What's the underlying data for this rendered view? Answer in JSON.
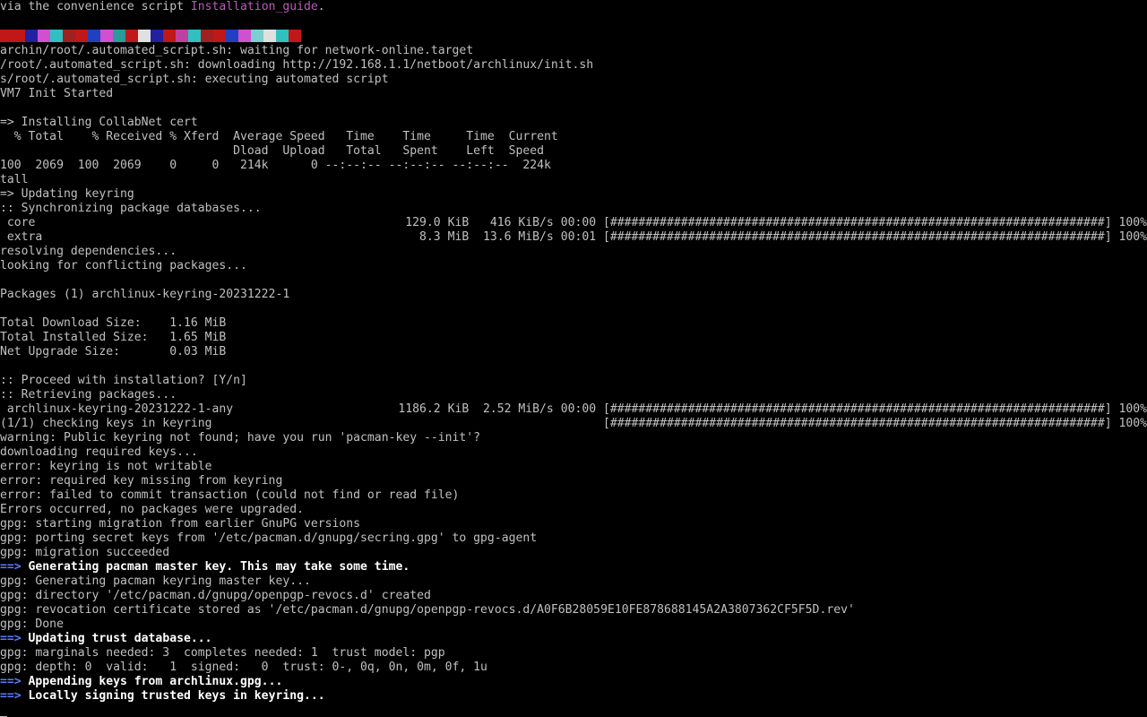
{
  "colors": {
    "background": "#000000",
    "text": "#c0c0c0",
    "bright": "#ffffff",
    "link": "#b85bb8",
    "arrow": "#5c7cff"
  },
  "banner_colors": [
    "#c01818",
    "#c01818",
    "#2020a0",
    "#d050d0",
    "#30c0c0",
    "#a02020",
    "#c01818",
    "#2040c0",
    "#d050d0",
    "#2a9a9a",
    "#c01818",
    "#e0e0e0",
    "#2020a0",
    "#c01818",
    "#c040a0",
    "#30c0c0",
    "#a02020",
    "#c01818",
    "#2040c0",
    "#d050d0",
    "#7ad0d0",
    "#e0e0e0",
    "#30c0c0",
    "#c01818"
  ],
  "lines": [
    {
      "text": "via the convenience script ",
      "link": "Installation_guide",
      "tail": "."
    },
    {
      "text": ""
    },
    {
      "banner": true
    },
    {
      "text": "archin/root/.automated_script.sh: waiting for network-online.target"
    },
    {
      "text": "/root/.automated_script.sh: downloading http://192.168.1.1/netboot/archlinux/init.sh"
    },
    {
      "text": "s/root/.automated_script.sh: executing automated script"
    },
    {
      "text": "VM7 Init Started"
    },
    {
      "text": ""
    },
    {
      "text": "=> Installing CollabNet cert"
    },
    {
      "text": "  % Total    % Received % Xferd  Average Speed   Time    Time     Time  Current"
    },
    {
      "text": "                                 Dload  Upload   Total   Spent    Left  Speed"
    },
    {
      "text": "100  2069  100  2069    0     0   214k      0 --:--:-- --:--:-- --:--:--  224k"
    },
    {
      "text": "tall"
    },
    {
      "text": "=> Updating keyring"
    },
    {
      "text": ":: Synchronizing package databases..."
    },
    {
      "text": " core",
      "right": "129.0 KiB   416 KiB/s 00:00 [######################################################################] 100%"
    },
    {
      "text": " extra",
      "right": "8.3 MiB  13.6 MiB/s 00:01 [######################################################################] 100%"
    },
    {
      "text": "resolving dependencies..."
    },
    {
      "text": "looking for conflicting packages..."
    },
    {
      "text": ""
    },
    {
      "text": "Packages (1) archlinux-keyring-20231222-1"
    },
    {
      "text": ""
    },
    {
      "text": "Total Download Size:    1.16 MiB"
    },
    {
      "text": "Total Installed Size:   1.65 MiB"
    },
    {
      "text": "Net Upgrade Size:       0.03 MiB"
    },
    {
      "text": ""
    },
    {
      "text": ":: Proceed with installation? [Y/n]"
    },
    {
      "text": ":: Retrieving packages..."
    },
    {
      "text": " archlinux-keyring-20231222-1-any",
      "right": "1186.2 KiB  2.52 MiB/s 00:00 [######################################################################] 100%"
    },
    {
      "text": "(1/1) checking keys in keyring",
      "right": "[######################################################################] 100%"
    },
    {
      "text": "warning: Public keyring not found; have you run 'pacman-key --init'?"
    },
    {
      "text": "downloading required keys..."
    },
    {
      "text": "error: keyring is not writable"
    },
    {
      "text": "error: required key missing from keyring"
    },
    {
      "text": "error: failed to commit transaction (could not find or read file)"
    },
    {
      "text": "Errors occurred, no packages were upgraded."
    },
    {
      "text": "gpg: starting migration from earlier GnuPG versions"
    },
    {
      "text": "gpg: porting secret keys from '/etc/pacman.d/gnupg/secring.gpg' to gpg-agent"
    },
    {
      "text": "gpg: migration succeeded"
    },
    {
      "arrow": "==>",
      "text": " Generating pacman master key. This may take some time.",
      "bold": true
    },
    {
      "text": "gpg: Generating pacman keyring master key..."
    },
    {
      "text": "gpg: directory '/etc/pacman.d/gnupg/openpgp-revocs.d' created"
    },
    {
      "text": "gpg: revocation certificate stored as '/etc/pacman.d/gnupg/openpgp-revocs.d/A0F6B28059E10FE878688145A2A3807362CF5F5D.rev'"
    },
    {
      "text": "gpg: Done"
    },
    {
      "arrow": "==>",
      "text": " Updating trust database...",
      "bold": true
    },
    {
      "text": "gpg: marginals needed: 3  completes needed: 1  trust model: pgp"
    },
    {
      "text": "gpg: depth: 0  valid:   1  signed:   0  trust: 0-, 0q, 0n, 0m, 0f, 1u"
    },
    {
      "arrow": "==>",
      "text": " Appending keys from archlinux.gpg...",
      "bold": true
    },
    {
      "arrow": "==>",
      "text": " Locally signing trusted keys in keyring...",
      "bold": true
    },
    {
      "text": ""
    }
  ]
}
